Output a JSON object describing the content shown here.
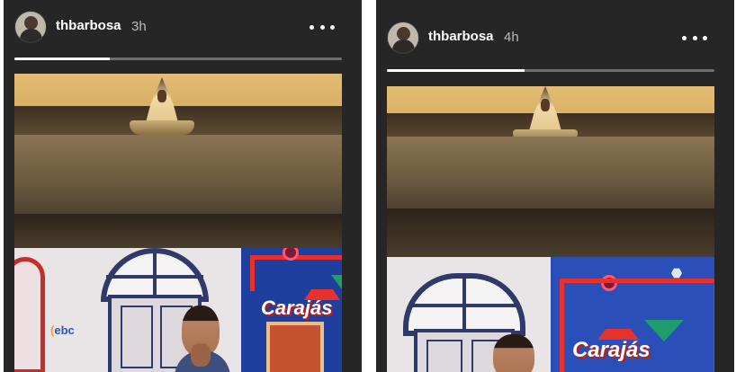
{
  "stories": [
    {
      "username": "thbarbosa",
      "timestamp": "3h",
      "progress": 0.29,
      "video": {
        "sign_text": "Carajás",
        "logo_text": "ebc"
      }
    },
    {
      "username": "thbarbosa",
      "timestamp": "4h",
      "progress": 0.42,
      "video": {
        "sign_text": "Carajás"
      }
    }
  ],
  "colors": {
    "background": "#262626",
    "progress_track": "#6f6f6f",
    "progress_fill": "#ffffff",
    "sign_blue": "#1f3f9e",
    "sign_red": "#e8302e"
  },
  "icons": [
    "avatar",
    "more-options-icon"
  ]
}
